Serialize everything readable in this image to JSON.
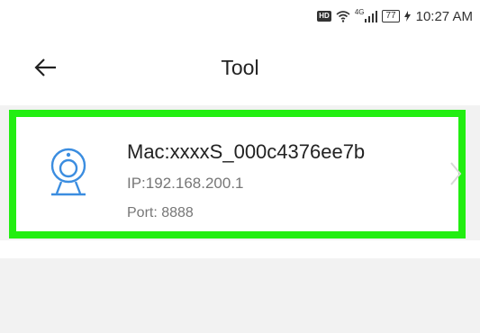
{
  "status_bar": {
    "hd": "HD",
    "network": "4G",
    "battery": "77",
    "time": "10:27 AM"
  },
  "header": {
    "title": "Tool"
  },
  "device": {
    "mac": "Mac:xxxxS_000c4376ee7b",
    "ip": "IP:192.168.200.1",
    "port": "Port: 8888"
  },
  "colors": {
    "highlight": "#22ee11",
    "accent": "#3b8de0"
  }
}
